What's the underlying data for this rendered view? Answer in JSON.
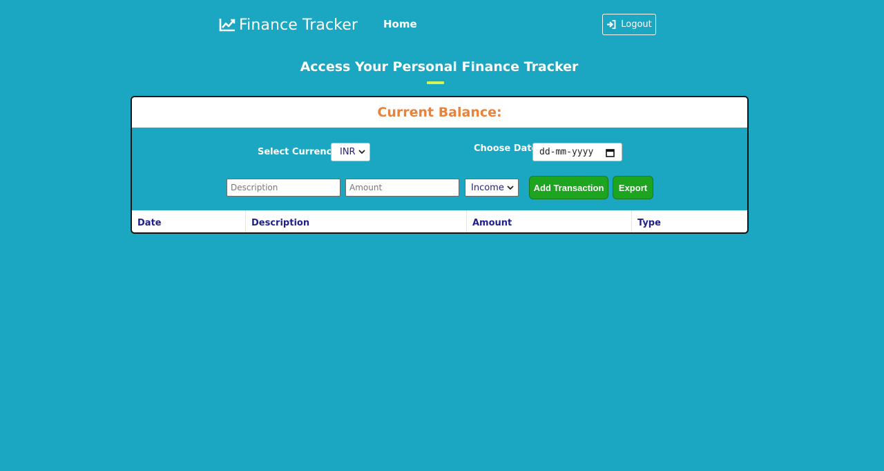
{
  "nav": {
    "brand": "Finance Tracker",
    "brand_icon": "line-chart-icon",
    "home_label": "Home",
    "logout_label": "Logout",
    "logout_icon": "sign-in-icon"
  },
  "page": {
    "heading": "Access Your Personal Finance Tracker",
    "accent_color": "#d4f55a",
    "background_color": "#1ba7c1"
  },
  "balance": {
    "label": "Current Balance:",
    "color": "#e9833b"
  },
  "controls": {
    "currency_label": "Select Currency:",
    "currency_value": "INR",
    "date_label": "Choose Date:",
    "date_value": "dd-mm-yyyy",
    "description_placeholder": "Description",
    "amount_placeholder": "Amount",
    "type_value": "Income",
    "add_label": "Add Transaction",
    "export_label": "Export",
    "button_color": "#1ea51f"
  },
  "table": {
    "columns": [
      "Date",
      "Description",
      "Amount",
      "Type"
    ]
  }
}
